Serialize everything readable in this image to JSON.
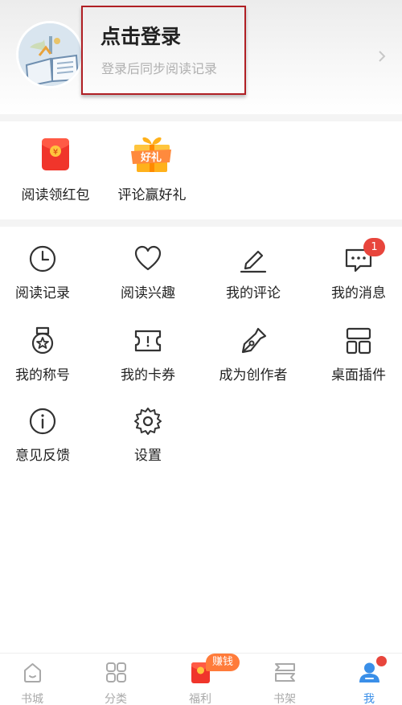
{
  "profile": {
    "login_title": "点击登录",
    "login_subtitle": "登录后同步阅读记录",
    "avatar_icon": "open-book-icon",
    "chevron_icon": "chevron-right-icon"
  },
  "promos": [
    {
      "label": "阅读领红包",
      "icon": "red-envelope-icon"
    },
    {
      "label": "评论赢好礼",
      "icon": "gift-box-icon",
      "gift_text": "好礼"
    }
  ],
  "menu": [
    {
      "label": "阅读记录",
      "icon": "clock-icon"
    },
    {
      "label": "阅读兴趣",
      "icon": "heart-icon"
    },
    {
      "label": "我的评论",
      "icon": "pencil-icon"
    },
    {
      "label": "我的消息",
      "icon": "message-icon",
      "badge": "1"
    },
    {
      "label": "我的称号",
      "icon": "medal-icon"
    },
    {
      "label": "我的卡券",
      "icon": "ticket-icon"
    },
    {
      "label": "成为创作者",
      "icon": "pen-nib-icon"
    },
    {
      "label": "桌面插件",
      "icon": "widget-icon"
    },
    {
      "label": "意见反馈",
      "icon": "info-icon"
    },
    {
      "label": "设置",
      "icon": "gear-icon"
    }
  ],
  "tabs": [
    {
      "label": "书城",
      "icon": "home-icon"
    },
    {
      "label": "分类",
      "icon": "grid-icon"
    },
    {
      "label": "福利",
      "icon": "red-envelope-icon",
      "badge": "赚钱"
    },
    {
      "label": "书架",
      "icon": "bookshelf-icon"
    },
    {
      "label": "我",
      "icon": "user-icon",
      "active": true
    }
  ],
  "colors": {
    "accent": "#3a8fe8",
    "badge_red": "#e8453c",
    "earn_orange": "#ff7b3a",
    "highlight_border": "#b01f24"
  }
}
